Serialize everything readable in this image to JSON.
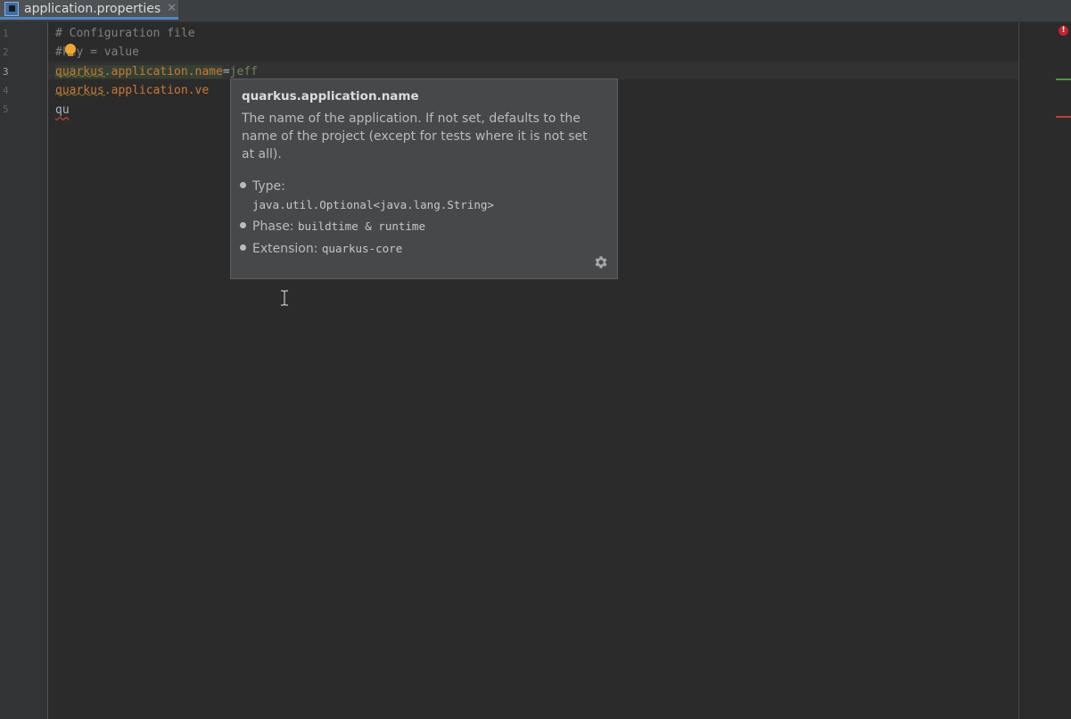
{
  "tab": {
    "label": "application.properties",
    "close": "✕",
    "icon": "properties-file-icon"
  },
  "gutter": {
    "lines": [
      "1",
      "2",
      "3",
      "4",
      "5"
    ]
  },
  "code": {
    "line1": "# Configuration file",
    "line2_hash": "#",
    "line2_rest": "key = value",
    "line3_key": "quarkus.application.name",
    "line3_eq": "=",
    "line3_val": "jeff",
    "line4": "quarkus.application.ve",
    "line5": "qu"
  },
  "popup": {
    "title": "quarkus.application.name",
    "description": "The name of the application. If not set, defaults to the name of the project (except for tests where it is not set at all).",
    "type_label": "Type:",
    "type_value": "java.util.Optional<java.lang.String>",
    "phase_label": "Phase:",
    "phase_value": "buildtime & runtime",
    "extension_label": "Extension:",
    "extension_value": "quarkus-core"
  },
  "indicators": {
    "error_glyph": "!"
  },
  "colors": {
    "background": "#2b2b2b",
    "keyword": "#cc7832",
    "value": "#6a8759",
    "comment": "#808080",
    "tab_underline": "#4a88c7",
    "error": "#c7222d"
  }
}
